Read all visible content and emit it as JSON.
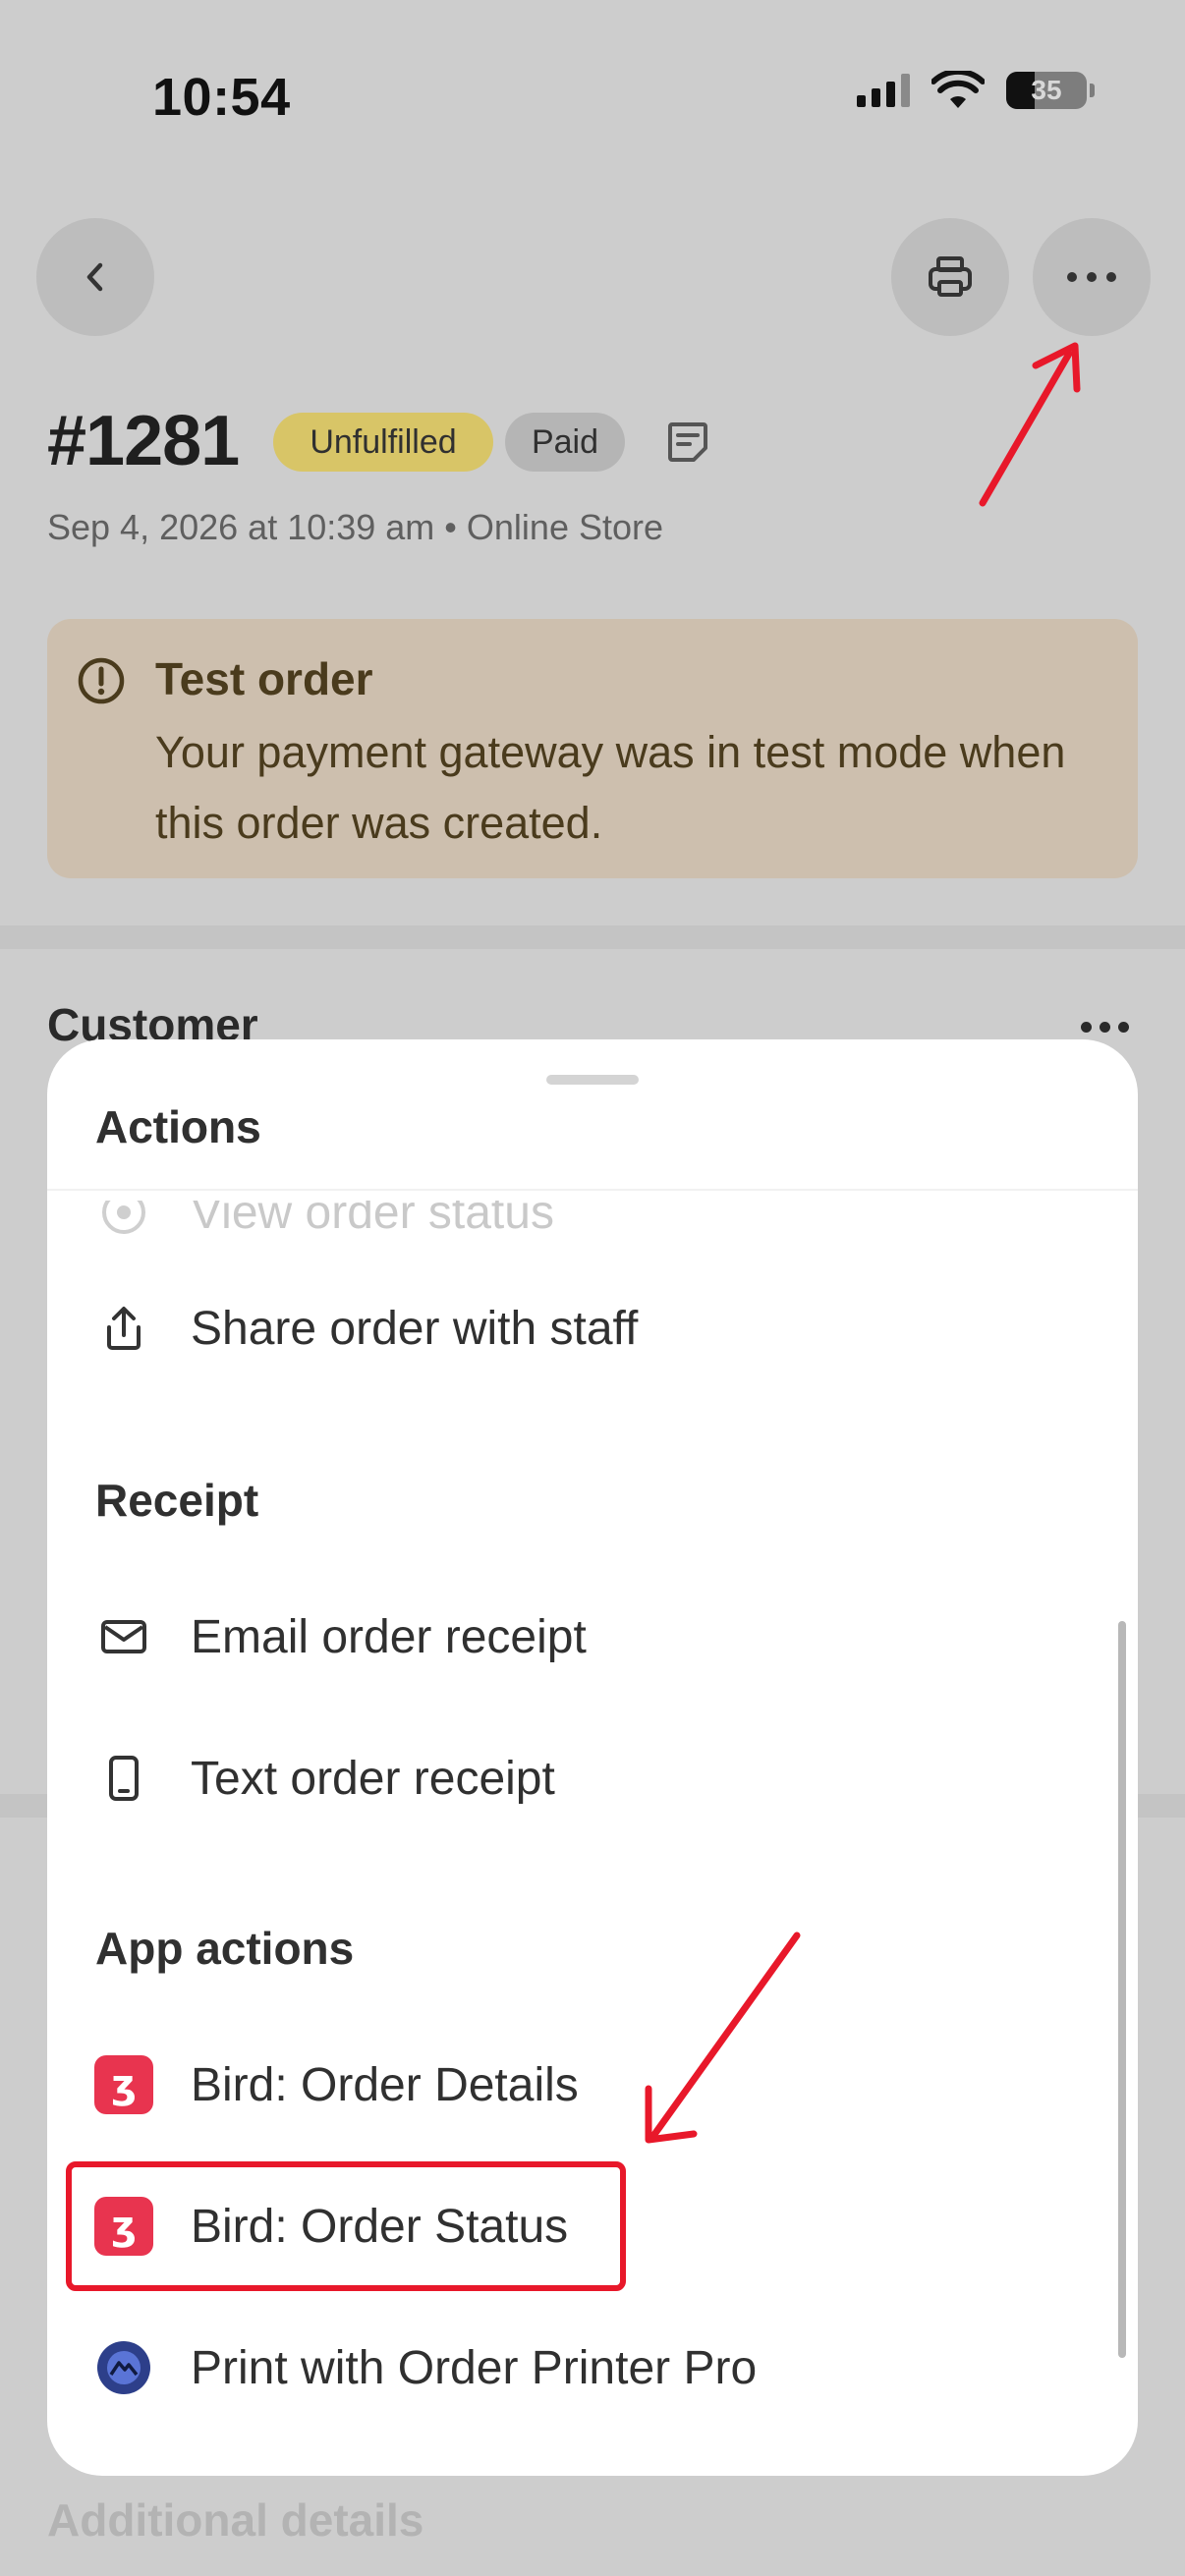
{
  "status_bar": {
    "time": "10:54",
    "battery": "35"
  },
  "nav": {
    "back_icon": "chevron-left-icon",
    "print_icon": "printer-icon",
    "more_icon": "ellipsis-icon"
  },
  "order": {
    "number": "#1281",
    "fulfillment_badge": "Unfulfilled",
    "payment_badge": "Paid",
    "meta": "Sep 4, 2026 at 10:39 am • Online Store"
  },
  "banner": {
    "title": "Test order",
    "text": "Your payment gateway was in test mode when this order was created."
  },
  "customer": {
    "heading": "Customer"
  },
  "additional_details": {
    "heading": "Additional details"
  },
  "sheet": {
    "actions_heading": "Actions",
    "actions": [
      {
        "label": "View order status",
        "icon": "eye-icon"
      },
      {
        "label": "Share order with staff",
        "icon": "share-icon"
      }
    ],
    "receipt_heading": "Receipt",
    "receipt": [
      {
        "label": "Email order receipt",
        "icon": "envelope-icon"
      },
      {
        "label": "Text order receipt",
        "icon": "phone-icon"
      }
    ],
    "app_actions_heading": "App actions",
    "app_actions": [
      {
        "label": "Bird: Order Details",
        "icon": "bird-app-icon"
      },
      {
        "label": "Bird: Order Status",
        "icon": "bird-app-icon"
      },
      {
        "label": "Print with Order Printer Pro",
        "icon": "order-printer-pro-icon"
      }
    ]
  },
  "colors": {
    "annotation_red": "#e8182a",
    "unfulfilled_badge": "#d8c567",
    "paid_badge": "#b5b5b5",
    "banner_bg": "#cdbfae",
    "bird_icon": "#e8344f"
  }
}
